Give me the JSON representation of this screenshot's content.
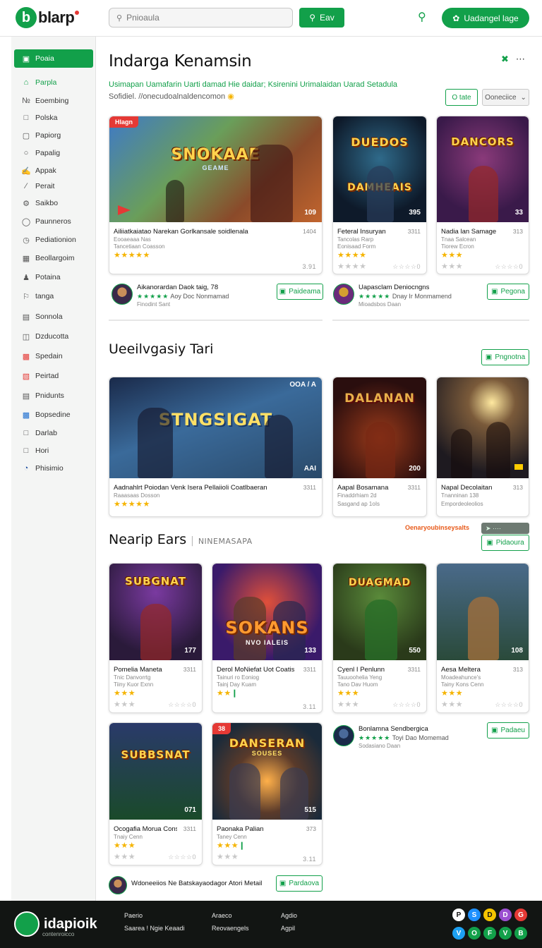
{
  "header": {
    "logo_mark": "b",
    "logo_text": "blarp",
    "search_placeholder": "Pnioaula",
    "search_button": "Eav",
    "signup_button": "Uadangel lage"
  },
  "sidebar": {
    "items": [
      {
        "label": "Poaia",
        "icon": "home-icon"
      },
      {
        "label": "Parpla",
        "icon": "bag-icon"
      },
      {
        "label": "Eoembing",
        "icon": "tag-icon"
      },
      {
        "label": "Polska",
        "icon": "square-icon"
      },
      {
        "label": "Papiorg",
        "icon": "box-icon"
      },
      {
        "label": "Papalig",
        "icon": "circle-icon"
      },
      {
        "label": "Appak",
        "icon": "pen-icon"
      },
      {
        "label": "Perait",
        "icon": "link-icon"
      },
      {
        "label": "Saikbo",
        "icon": "gear-icon"
      },
      {
        "label": "Paunneros",
        "icon": "chat-icon"
      },
      {
        "label": "Pediationion",
        "icon": "clock-icon"
      },
      {
        "label": "Beollargoim",
        "icon": "grid-icon"
      },
      {
        "label": "Potaina",
        "icon": "person-icon"
      },
      {
        "label": "tanga",
        "icon": "flag-icon"
      },
      {
        "label": "Sonnola",
        "icon": "doc-icon"
      },
      {
        "label": "Dzducotta",
        "icon": "folder-icon"
      },
      {
        "label": "Spedain",
        "icon": "red-grid-icon"
      },
      {
        "label": "Peirtad",
        "icon": "bookmark-icon"
      },
      {
        "label": "Pnidunts",
        "icon": "list-icon"
      },
      {
        "label": "Bopsedine",
        "icon": "blue-box-icon"
      },
      {
        "label": "Darlab",
        "icon": "page-icon"
      },
      {
        "label": "Hori",
        "icon": "file-icon"
      },
      {
        "label": "Phisimio",
        "icon": "globe-icon"
      }
    ]
  },
  "main": {
    "title": "Indarga Kenamsin",
    "subtitle": "Usimapan Uamafarin Uarti damad Hie daidar; Ksirenini Urimalaidan Uarad Setadula",
    "subtitle_link": "Sofidiel. //onecudoalnaldencomon",
    "filter_rate": "O tate",
    "filter_select": "Ooneciice",
    "section2_title": "Ueeilvgasiy Tari",
    "section2_button": "Pngnotna",
    "section3_title": "Nearip Ears",
    "section3_sub": "NINEMASAPA",
    "section3_orange": "Oenaryoubinseysalts",
    "section3_button": "Pidaoura"
  },
  "featured_cards": [
    {
      "title": "Ailiiatkaiatao Narekan Gorlkansale soidlenala",
      "meta": "1404",
      "sub1": "Eooaeaaa Nas",
      "sub2": "Tancetiaan Coasson",
      "rating": "3.91",
      "art": "SNOKAAE",
      "art_sub": "GEAME",
      "num": "109",
      "tag": "Hlagn"
    },
    {
      "title": "Feteral Insuryan",
      "meta": "3311",
      "sub1": "Tancolas Rarp",
      "sub2": "Eonisaad Form",
      "art": "DUEDOS",
      "art_sub": "DAMHEAIS",
      "num": "395"
    },
    {
      "title": "Nadia lan Samage",
      "meta": "313",
      "sub1": "Tnaa Salcean",
      "sub2": "Tiorew Ecron",
      "art": "DANCORS",
      "art_sub": "",
      "num": "33"
    }
  ],
  "promos_top": [
    {
      "title": "Aikanorardan Daok taig, 78",
      "line_stars": "★★★★★",
      "line": "Aoy Doc Nonmamad",
      "sub": "Finodint Sant",
      "button": "Paideama"
    },
    {
      "title": "Uapasclam Deniocngns",
      "line_stars": "★★★★★",
      "line": "Dnay Ir Monmamend",
      "sub": "Mioadsbos Daan",
      "button": "Pegona"
    }
  ],
  "section2_cards": [
    {
      "title": "Aadnahlrt Poiodan Venk Isera Pellaiioli Coatlbaeran",
      "meta": "3311",
      "sub": "Raaasaas Dosson",
      "art": "STNGSIGAT",
      "art_sub": "",
      "num": "AAI",
      "top_icons": "OOA / A"
    },
    {
      "title": "Aapal Bosamana",
      "meta": "3311",
      "sub1": "Finaddrhiam 2d",
      "sub2": "Sasgand ap 1oIs",
      "art": "DALANAN",
      "art_sub": "",
      "num": "200"
    },
    {
      "title": "Napal Decolaitan",
      "meta": "313",
      "sub1": "Tnanninan 138",
      "sub2": "Empordeoleolios",
      "art": "",
      "art_sub": "",
      "num": ""
    }
  ],
  "section3_cards": [
    {
      "title": "Pomelia Maneta",
      "meta": "3311",
      "sub1": "Tnic Danvorrtg",
      "sub2": "Tiiny Kuor Exnn",
      "rating": "",
      "art": "SUBGNAT",
      "num": "177"
    },
    {
      "title": "Derol MoNiefat Uot Coatisan",
      "meta": "3311",
      "sub1": "Tainuri ro Eoniog",
      "sub2": "Tainj Day Kuam",
      "rating": "3.11",
      "art": "SOKANS",
      "art_sub": "NVO IALEIS",
      "num": "133"
    },
    {
      "title": "Cyenl I Penlunn",
      "meta": "3311",
      "sub1": "Tauuoohelia Yeng",
      "sub2": "Tano Dav Huom",
      "rating": "",
      "art": "DUAGMAD",
      "num": "550"
    },
    {
      "title": "Aesa Meltera",
      "meta": "313",
      "sub1": "Moadeahunce's",
      "sub2": "Tainy Kons Cenn",
      "rating": "",
      "art": "",
      "num": "108"
    },
    {
      "title": "Ocogafia Morua Cons",
      "meta": "3311",
      "sub1": "Tnaiy Cenn",
      "sub2": "",
      "rating": "",
      "art": "SUBBSNAT",
      "num": "071"
    },
    {
      "title": "Paonaka Palian",
      "meta": "373",
      "sub1": "Taney Cenn",
      "sub2": "",
      "rating": "3.11",
      "art": "DANSERAN",
      "art_sub": "SOUSES",
      "num": "515",
      "tag": "38"
    }
  ],
  "promo_side": {
    "title": "Bonlamna Sendbergica",
    "line_stars": "★★★★★",
    "line": "Toyi Dao Momemad",
    "sub": "Sodasiano Daan",
    "button": "Padaeu"
  },
  "promo_bottom": {
    "title": "Wdoneeiios Ne Batskayaodagor Atori Metail",
    "button": "Pardaova"
  },
  "rating_placeholder": "☆☆☆☆0",
  "footer": {
    "name": "idapioik",
    "tag": "contenroicco",
    "col1": [
      "Paerio",
      "Saarea ! Ngie Keaadi"
    ],
    "col2": [
      "Araeco",
      "Reovaengels"
    ],
    "col3": [
      "Agdio",
      "Agpil"
    ],
    "social": [
      "P",
      "S",
      "D",
      "D",
      "G",
      "V",
      "O",
      "F",
      "V",
      "B"
    ]
  },
  "colors": {
    "accent": "#12a04a",
    "alert": "#e53935",
    "star": "#f5b400"
  }
}
